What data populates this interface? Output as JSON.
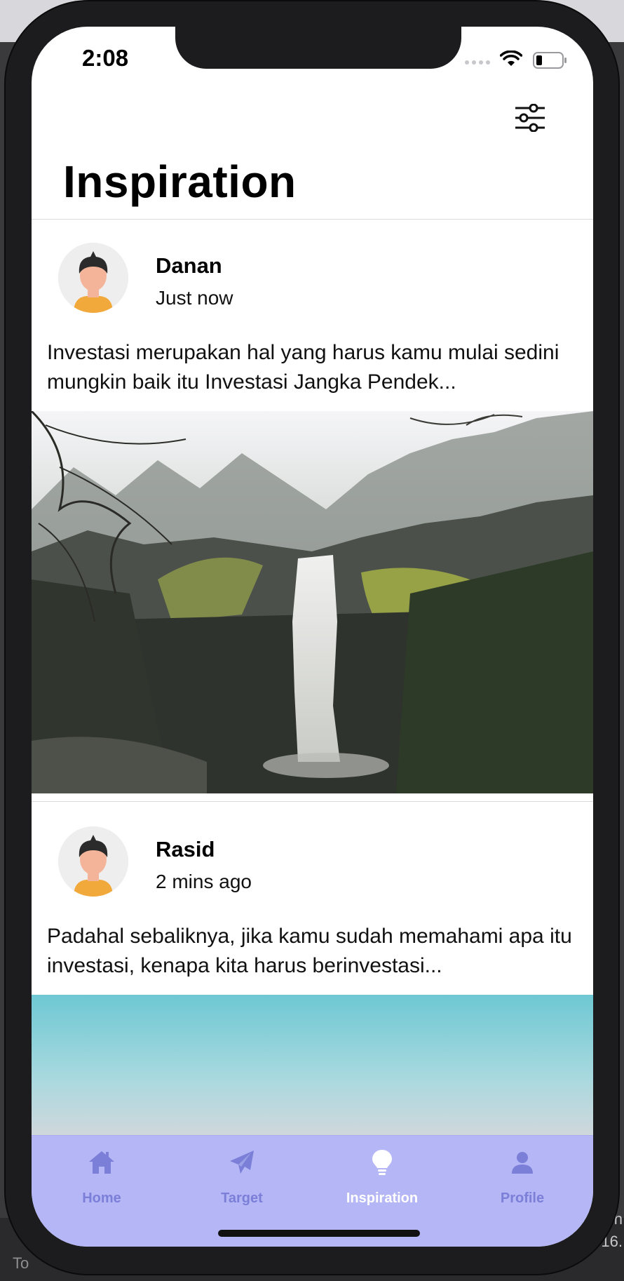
{
  "status_bar": {
    "time": "2:08"
  },
  "header": {
    "title": "Inspiration"
  },
  "posts": [
    {
      "author": "Danan",
      "time": "Just now",
      "caption": "Investasi merupakan hal yang harus kamu mulai sedini mungkin baik itu Investasi Jangka Pendek..."
    },
    {
      "author": "Rasid",
      "time": "2 mins ago",
      "caption": "Padahal sebaliknya, jika kamu sudah memahami apa itu investasi, kenapa kita harus berinvestasi..."
    }
  ],
  "tabs": [
    {
      "label": "Home",
      "icon": "home-icon"
    },
    {
      "label": "Target",
      "icon": "paper-plane-icon"
    },
    {
      "label": "Inspiration",
      "icon": "lightbulb-icon",
      "active": true
    },
    {
      "label": "Profile",
      "icon": "user-icon"
    }
  ],
  "colors": {
    "tab_bar_bg": "#b5b6f5",
    "tab_inactive": "#7b7fd8",
    "tab_active": "#ffffff",
    "avatar_shirt": "#f2a93b",
    "avatar_skin": "#f4b49a"
  },
  "desktop": {
    "left_text": "To",
    "right_text_1": "h",
    "right_text_2": "16."
  }
}
